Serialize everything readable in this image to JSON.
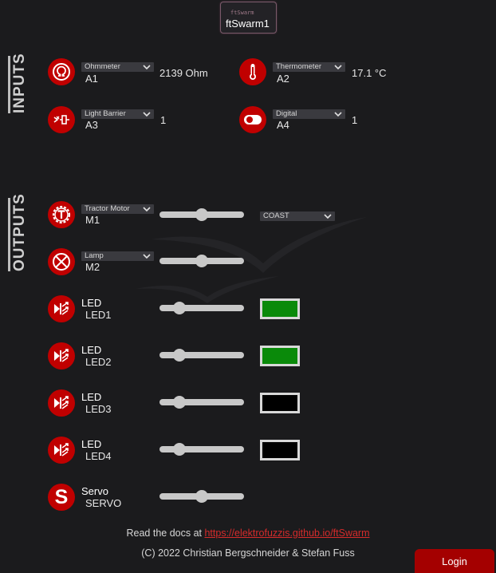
{
  "header": {
    "brand_small": "ftSwarm",
    "device_name": "ftSwarm1"
  },
  "inputs": {
    "section_label": "INPUTS",
    "items": [
      {
        "icon": "ohm-icon",
        "type": "Ohmmeter",
        "port": "A1",
        "value": "2139 Ohm"
      },
      {
        "icon": "thermometer-icon",
        "type": "Thermometer",
        "port": "A2",
        "value": "17.1 °C"
      },
      {
        "icon": "light-barrier-icon",
        "type": "Light Barrier",
        "port": "A3",
        "value": "1"
      },
      {
        "icon": "toggle-switch-icon",
        "type": "Digital",
        "port": "A4",
        "value": "1"
      }
    ]
  },
  "outputs": {
    "section_label": "OUTPUTS",
    "items": [
      {
        "icon": "tractor-motor-icon",
        "type": "Tractor Motor",
        "port": "M1",
        "slider": 0.5,
        "mode": "COAST"
      },
      {
        "icon": "lamp-icon",
        "type": "Lamp",
        "port": "M2",
        "slider": 0.5
      },
      {
        "icon": "led-icon",
        "type": "LED",
        "port": "LED1",
        "slider": 0.24,
        "color": "#0a8a0a"
      },
      {
        "icon": "led-icon",
        "type": "LED",
        "port": "LED2",
        "slider": 0.24,
        "color": "#0a8a0a"
      },
      {
        "icon": "led-icon",
        "type": "LED",
        "port": "LED3",
        "slider": 0.24,
        "color": "#000000"
      },
      {
        "icon": "led-icon",
        "type": "LED",
        "port": "LED4",
        "slider": 0.24,
        "color": "#000000"
      },
      {
        "icon": "servo-icon",
        "type": "Servo",
        "port": "SERVO",
        "slider": 0.5
      }
    ]
  },
  "footer": {
    "docs_prefix": "Read the docs at ",
    "docs_link": "https://elektrofuzzis.github.io/ftSwarm",
    "copyright": "(C) 2022 Christian Bergschneider & Stefan Fuss"
  },
  "login_label": "Login",
  "colors": {
    "accent": "#c00000",
    "background": "#1b1b1d"
  }
}
